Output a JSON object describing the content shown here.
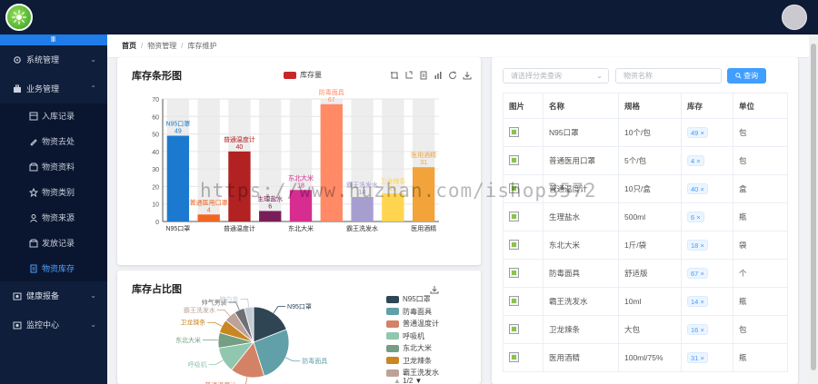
{
  "header": {
    "logo_icon": "kiwi-logo-icon",
    "avatar_icon": "user-avatar"
  },
  "sidebar": {
    "collapse_label": "Ⅲ",
    "menus": [
      {
        "label": "系统管理",
        "icon": "gear-icon",
        "chevron": "chevron-down"
      },
      {
        "label": "业务管理",
        "icon": "briefcase-icon",
        "chevron": "chevron-up"
      }
    ],
    "sub_items": [
      {
        "label": "入库记录",
        "icon": "table-icon"
      },
      {
        "label": "物资去处",
        "icon": "edit-icon"
      },
      {
        "label": "物资资料",
        "icon": "box-icon"
      },
      {
        "label": "物资类别",
        "icon": "star-icon"
      },
      {
        "label": "物资来源",
        "icon": "user-icon"
      },
      {
        "label": "发放记录",
        "icon": "box-icon"
      },
      {
        "label": "物资库存",
        "icon": "document-icon",
        "active": true
      }
    ],
    "bottom_menus": [
      {
        "label": "健康报备",
        "icon": "camera-icon"
      },
      {
        "label": "监控中心",
        "icon": "camera-icon"
      }
    ]
  },
  "breadcrumb": {
    "items": [
      "首页",
      "物资管理",
      "库存维护"
    ],
    "separator": "/"
  },
  "bar_chart_card": {
    "title": "库存条形图"
  },
  "pie_chart_card": {
    "title": "库存占比图",
    "pager": "1/2"
  },
  "watermark": "https://www.huzhan.com/ishop3572",
  "chart_data": [
    {
      "type": "bar",
      "title": "库存条形图",
      "series": [
        {
          "name": "库存量",
          "values": [
            49,
            4,
            40,
            6,
            18,
            67,
            14,
            16,
            31
          ]
        }
      ],
      "categories": [
        "N95口罩",
        "普通医用口罩",
        "普通温度计",
        "生理盐水",
        "东北大米",
        "防毒面具",
        "霸王洗发水",
        "卫龙辣条",
        "医用酒精"
      ],
      "category_ticks": [
        "N95口罩",
        "普通温度计",
        "东北大米",
        "霸王洗发水",
        "医用酒精"
      ],
      "label_overlap_names": [
        "普通医用口罩",
        "生理盐水",
        "卫龙辣条"
      ],
      "colors": [
        "#1b7ad0",
        "#f26522",
        "#b22222",
        "#7a1e5a",
        "#d72d91",
        "#ff8a65",
        "#a79ed0",
        "#ffd54f",
        "#f2a33a"
      ],
      "ylim": [
        0,
        70
      ],
      "yticks": [
        0,
        10,
        20,
        30,
        40,
        50,
        60,
        70
      ],
      "legend_color": "#c62828"
    },
    {
      "type": "pie",
      "title": "库存占比图",
      "slices": [
        {
          "label": "N95口罩",
          "value": 49,
          "color": "#2f4554"
        },
        {
          "label": "防毒面具",
          "value": 67,
          "color": "#61a0a8"
        },
        {
          "label": "普通温度计",
          "value": 40,
          "color": "#d48265"
        },
        {
          "label": "呼吸机",
          "value": 30,
          "color": "#91c7ae"
        },
        {
          "label": "东北大米",
          "value": 18,
          "color": "#749f83"
        },
        {
          "label": "卫龙辣条",
          "value": 16,
          "color": "#ca8622"
        },
        {
          "label": "霸王洗发水",
          "value": 14,
          "color": "#bda29a"
        },
        {
          "label": "帅气男装",
          "value": 12,
          "color": "#6e7074"
        },
        {
          "label": "脑白金",
          "value": 11,
          "color": "#c4ccd3"
        }
      ],
      "legend_visible": [
        "N95口罩",
        "防毒面具",
        "普通温度计",
        "呼吸机",
        "东北大米",
        "卫龙辣条",
        "霸王洗发水"
      ]
    }
  ],
  "filters": {
    "category_placeholder": "请选择分类查询",
    "name_placeholder": "物资名称",
    "query_button": "查询"
  },
  "table": {
    "headers": [
      "图片",
      "名称",
      "规格",
      "库存",
      "单位"
    ],
    "rows": [
      {
        "name": "N95口罩",
        "spec": "10个/包",
        "stock": "49",
        "unit": "包"
      },
      {
        "name": "普通医用口罩",
        "spec": "5个/包",
        "stock": "4",
        "unit": "包"
      },
      {
        "name": "普通温度计",
        "spec": "10只/盒",
        "stock": "40",
        "unit": "盒"
      },
      {
        "name": "生理盐水",
        "spec": "500ml",
        "stock": "6",
        "unit": "瓶"
      },
      {
        "name": "东北大米",
        "spec": "1斤/袋",
        "stock": "18",
        "unit": "袋"
      },
      {
        "name": "防毒面具",
        "spec": "舒适版",
        "stock": "67",
        "unit": "个"
      },
      {
        "name": "霸王洗发水",
        "spec": "10ml",
        "stock": "14",
        "unit": "瓶"
      },
      {
        "name": "卫龙辣条",
        "spec": "大包",
        "stock": "16",
        "unit": "包"
      },
      {
        "name": "医用酒精",
        "spec": "100ml/75%",
        "stock": "31",
        "unit": "瓶"
      }
    ],
    "tag_close": "×"
  }
}
